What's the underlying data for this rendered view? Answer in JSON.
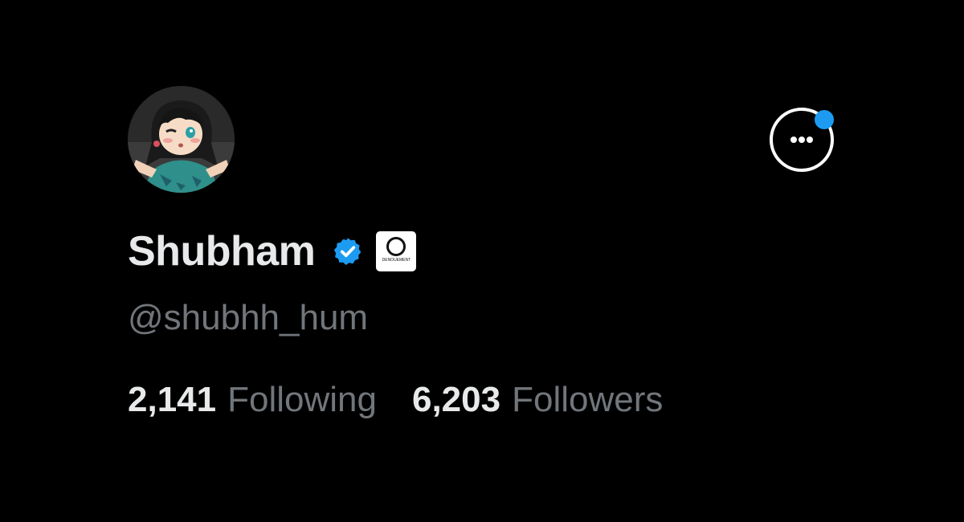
{
  "profile": {
    "display_name": "Shubham",
    "handle": "@shubhh_hum",
    "verified": true,
    "affiliate_badge_text": "DENOUEMENT",
    "avatar_description_icon": "anime-avatar"
  },
  "stats": {
    "following_count": "2,141",
    "following_label": "Following",
    "followers_count": "6,203",
    "followers_label": "Followers"
  },
  "actions": {
    "more_icon": "more-options-icon",
    "has_notification_dot": true
  },
  "colors": {
    "background": "#000000",
    "primary_text": "#e7e9ea",
    "secondary_text": "#71767b",
    "accent": "#1d9bf0"
  }
}
